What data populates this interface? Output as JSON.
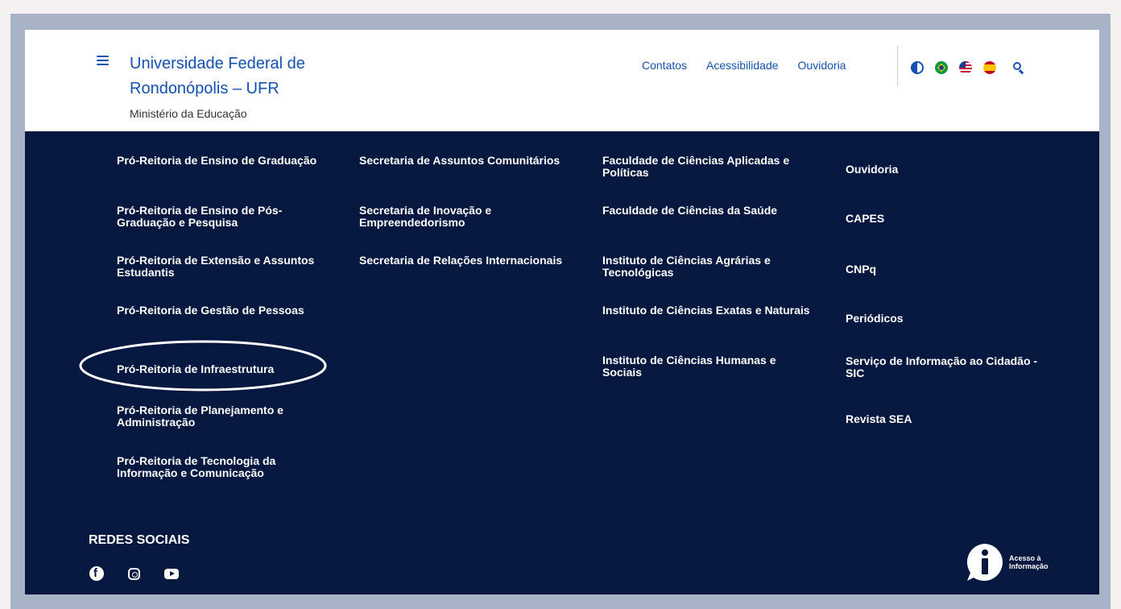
{
  "header": {
    "site_title": "Universidade Federal de Rondonópolis – UFR",
    "ministry": "Ministério da Educação",
    "links": [
      "Contatos",
      "Acessibilidade",
      "Ouvidoria"
    ]
  },
  "tools": {
    "icons": [
      "contrast-icon",
      "flag-brazil-icon",
      "flag-usa-icon",
      "flag-spain-icon",
      "search-icon"
    ]
  },
  "menu": {
    "col1": [
      "Pró-Reitoria de Ensino de Graduação",
      "Pró-Reitoria de Ensino de Pós-Graduação e Pesquisa",
      "Pró-Reitoria de Extensão e Assuntos Estudantis",
      "Pró-Reitoria de Gestão de Pessoas",
      "Pró-Reitoria de Infraestrutura",
      "Pró-Reitoria de Planejamento e Administração",
      "Pró-Reitoria de Tecnologia da Informação e Comunicação"
    ],
    "col2": [
      "Secretaria de Assuntos Comunitários",
      "Secretaria de Inovação e Empreendedorismo",
      "Secretaria de Relações Internacionais"
    ],
    "col3": [
      "Faculdade de Ciências Aplicadas e Políticas",
      "Faculdade de Ciências da Saúde",
      "Instituto de Ciências Agrárias e Tecnológicas",
      "Instituto de Ciências Exatas e Naturais",
      "Instituto de Ciências Humanas e Sociais"
    ],
    "col4": [
      "Ouvidoria",
      "CAPES",
      "CNPq",
      "Periódicos",
      "Serviço de Informação ao Cidadão - SIC",
      "Revista SEA"
    ]
  },
  "social": {
    "title": "REDES SOCIAIS",
    "icons": [
      "facebook-icon",
      "instagram-icon",
      "youtube-icon"
    ]
  },
  "acesso": {
    "label": "Acesso à Informação"
  },
  "colors": {
    "brand_blue": "#1351b4",
    "footer_bg": "#06183f",
    "frame": "#a8b3c8"
  }
}
